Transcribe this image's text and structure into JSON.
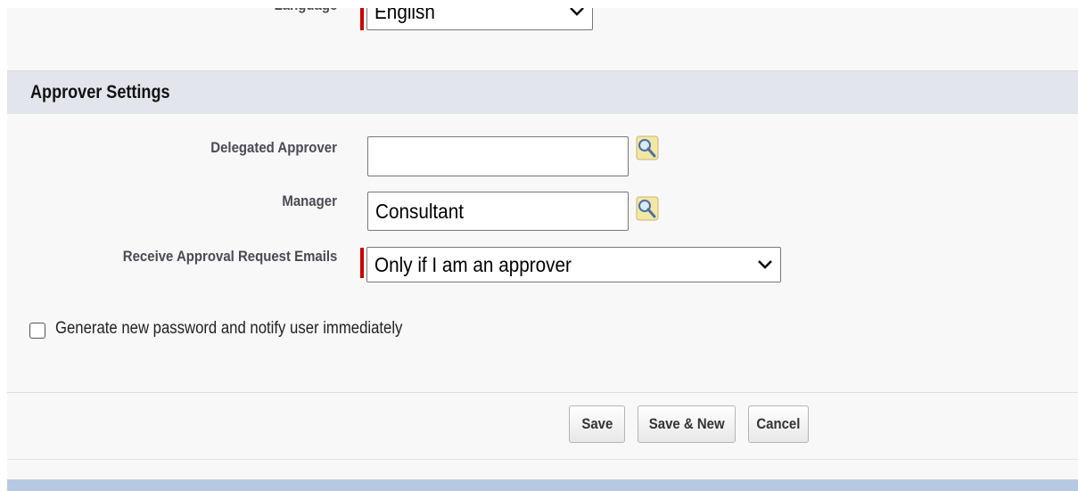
{
  "settings": {
    "language_label": "Language",
    "language_value": "English"
  },
  "approver_settings": {
    "title": "Approver Settings",
    "delegated_approver_label": "Delegated Approver",
    "delegated_approver_value": "",
    "manager_label": "Manager",
    "manager_value": "Consultant",
    "receive_emails_label": "Receive Approval Request Emails",
    "receive_emails_value": "Only if I am an approver"
  },
  "options": {
    "generate_password_label": "Generate new password and notify user immediately",
    "generate_password_checked": false
  },
  "buttons": {
    "save": "Save",
    "save_new": "Save & New",
    "cancel": "Cancel"
  },
  "colors": {
    "required_bar": "#cc0000",
    "section_header_bg": "#e3e5ec",
    "bottom_bar": "#b7c9e2"
  },
  "icons": {
    "lookup": "lookup-magnifier-icon",
    "dropdown": "chevron-down-icon"
  }
}
